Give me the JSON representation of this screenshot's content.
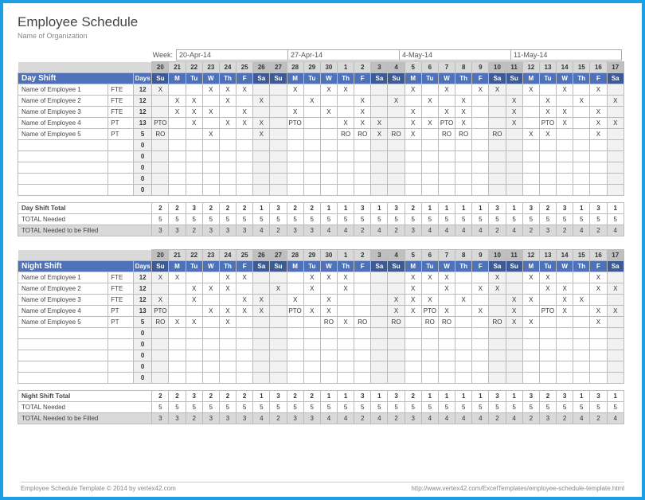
{
  "title": "Employee Schedule",
  "subtitle": "Name of Organization",
  "week_label": "Week:",
  "week_dates": [
    "20-Apr-14",
    "27-Apr-14",
    "4-May-14",
    "11-May-14"
  ],
  "day_nums": [
    "20",
    "21",
    "22",
    "23",
    "24",
    "25",
    "26",
    "27",
    "28",
    "29",
    "30",
    "1",
    "2",
    "3",
    "4",
    "5",
    "6",
    "7",
    "8",
    "9",
    "10",
    "11",
    "12",
    "13",
    "14",
    "15",
    "16",
    "17"
  ],
  "dow": [
    "Su",
    "M",
    "Tu",
    "W",
    "Th",
    "F",
    "Sa",
    "Su",
    "M",
    "Tu",
    "W",
    "Th",
    "F",
    "Sa",
    "Su",
    "M",
    "Tu",
    "W",
    "Th",
    "F",
    "Sa",
    "Su",
    "M",
    "Tu",
    "W",
    "Th",
    "F",
    "Sa"
  ],
  "weekend_idx": [
    0,
    6,
    7,
    13,
    14,
    20,
    21,
    27
  ],
  "shifts": [
    {
      "name": "Day Shift",
      "days_hdr": "Days",
      "employees": [
        {
          "name": "Name of Employee 1",
          "type": "FTE",
          "days": "12",
          "marks": [
            "X",
            "",
            "",
            "X",
            "X",
            "X",
            "",
            "",
            "X",
            "",
            "X",
            "X",
            "",
            "",
            "",
            "X",
            "",
            "X",
            "",
            "X",
            "X",
            "",
            "X",
            "",
            "X",
            "",
            "X",
            ""
          ]
        },
        {
          "name": "Name of Employee 2",
          "type": "FTE",
          "days": "12",
          "marks": [
            "",
            "X",
            "X",
            "",
            "X",
            "",
            "X",
            "",
            "",
            "X",
            "",
            "",
            "X",
            "",
            "X",
            "",
            "X",
            "",
            "X",
            "",
            "",
            "X",
            "",
            "X",
            "",
            "X",
            "",
            "X"
          ]
        },
        {
          "name": "Name of Employee 3",
          "type": "FTE",
          "days": "12",
          "marks": [
            "",
            "X",
            "X",
            "X",
            "",
            "X",
            "",
            "",
            "X",
            "",
            "X",
            "",
            "X",
            "",
            "",
            "X",
            "",
            "X",
            "X",
            "",
            "",
            "X",
            "",
            "X",
            "X",
            "",
            "X",
            ""
          ]
        },
        {
          "name": "Name of Employee 4",
          "type": "PT",
          "days": "13",
          "marks": [
            "PTO",
            "",
            "X",
            "",
            "X",
            "X",
            "X",
            "",
            "PTO",
            "",
            "",
            "X",
            "X",
            "X",
            "",
            "X",
            "X",
            "PTO",
            "X",
            "",
            "",
            "X",
            "",
            "PTO",
            "X",
            "",
            "X",
            "X"
          ]
        },
        {
          "name": "Name of Employee 5",
          "type": "PT",
          "days": "5",
          "marks": [
            "RO",
            "",
            "",
            "X",
            "",
            "",
            "X",
            "",
            "",
            "",
            "",
            "RO",
            "RO",
            "X",
            "RO",
            "X",
            "",
            "RO",
            "RO",
            "",
            "RO",
            "",
            "X",
            "X",
            "",
            "",
            "X",
            ""
          ]
        }
      ],
      "empty_rows": 5,
      "summary": [
        {
          "label": "Day Shift Total",
          "vals": [
            "2",
            "2",
            "3",
            "2",
            "2",
            "2",
            "1",
            "3",
            "2",
            "2",
            "1",
            "1",
            "3",
            "1",
            "3",
            "2",
            "1",
            "1",
            "1",
            "1",
            "3",
            "1",
            "3",
            "2",
            "3",
            "1",
            "3",
            "1"
          ],
          "cls": "total"
        },
        {
          "label": "TOTAL Needed",
          "vals": [
            "5",
            "5",
            "5",
            "5",
            "5",
            "5",
            "5",
            "5",
            "5",
            "5",
            "5",
            "5",
            "5",
            "5",
            "5",
            "5",
            "5",
            "5",
            "5",
            "5",
            "5",
            "5",
            "5",
            "5",
            "5",
            "5",
            "5",
            "5"
          ],
          "cls": "needed"
        },
        {
          "label": "TOTAL Needed to be Filled",
          "vals": [
            "3",
            "3",
            "2",
            "3",
            "3",
            "3",
            "4",
            "2",
            "3",
            "3",
            "4",
            "4",
            "2",
            "4",
            "2",
            "3",
            "4",
            "4",
            "4",
            "4",
            "2",
            "4",
            "2",
            "3",
            "2",
            "4",
            "2",
            "4"
          ],
          "cls": "fill"
        }
      ]
    },
    {
      "name": "Night Shift",
      "days_hdr": "Days",
      "employees": [
        {
          "name": "Name of Employee 1",
          "type": "FTE",
          "days": "12",
          "marks": [
            "X",
            "X",
            "",
            "",
            "X",
            "X",
            "",
            "",
            "",
            "X",
            "X",
            "X",
            "",
            "",
            "",
            "X",
            "X",
            "X",
            "",
            "",
            "X",
            "",
            "X",
            "X",
            "",
            "",
            "X",
            ""
          ]
        },
        {
          "name": "Name of Employee 2",
          "type": "FTE",
          "days": "12",
          "marks": [
            "",
            "",
            "X",
            "X",
            "X",
            "",
            "",
            "X",
            "",
            "X",
            "",
            "X",
            "",
            "",
            "",
            "X",
            "",
            "X",
            "",
            "X",
            "X",
            "",
            "",
            "X",
            "X",
            "",
            "X",
            "X"
          ]
        },
        {
          "name": "Name of Employee 3",
          "type": "FTE",
          "days": "12",
          "marks": [
            "X",
            "",
            "X",
            "",
            "",
            "X",
            "X",
            "",
            "X",
            "",
            "X",
            "",
            "",
            "",
            "X",
            "X",
            "X",
            "",
            "X",
            "",
            "",
            "X",
            "X",
            "",
            "X",
            "X",
            "",
            ""
          ]
        },
        {
          "name": "Name of Employee 4",
          "type": "PT",
          "days": "13",
          "marks": [
            "PTO",
            "",
            "",
            "X",
            "X",
            "X",
            "X",
            "",
            "PTO",
            "X",
            "X",
            "",
            "",
            "",
            "X",
            "X",
            "PTO",
            "X",
            "",
            "X",
            "",
            "X",
            "",
            "PTO",
            "X",
            "",
            "X",
            "X"
          ]
        },
        {
          "name": "Name of Employee 5",
          "type": "PT",
          "days": "5",
          "marks": [
            "RO",
            "X",
            "X",
            "",
            "X",
            "",
            "",
            "",
            "",
            "",
            "RO",
            "X",
            "RO",
            "",
            "RO",
            "",
            "RO",
            "RO",
            "",
            "",
            "RO",
            "X",
            "X",
            "",
            "",
            "",
            "X",
            ""
          ]
        }
      ],
      "empty_rows": 5,
      "summary": [
        {
          "label": "Night Shift Total",
          "vals": [
            "2",
            "2",
            "3",
            "2",
            "2",
            "2",
            "1",
            "3",
            "2",
            "2",
            "1",
            "1",
            "3",
            "1",
            "3",
            "2",
            "1",
            "1",
            "1",
            "1",
            "3",
            "1",
            "3",
            "2",
            "3",
            "1",
            "3",
            "1"
          ],
          "cls": "total"
        },
        {
          "label": "TOTAL Needed",
          "vals": [
            "5",
            "5",
            "5",
            "5",
            "5",
            "5",
            "5",
            "5",
            "5",
            "5",
            "5",
            "5",
            "5",
            "5",
            "5",
            "5",
            "5",
            "5",
            "5",
            "5",
            "5",
            "5",
            "5",
            "5",
            "5",
            "5",
            "5",
            "5"
          ],
          "cls": "needed"
        },
        {
          "label": "TOTAL Needed to be Filled",
          "vals": [
            "3",
            "3",
            "2",
            "3",
            "3",
            "3",
            "4",
            "2",
            "3",
            "3",
            "4",
            "4",
            "2",
            "4",
            "2",
            "3",
            "4",
            "4",
            "4",
            "4",
            "2",
            "4",
            "2",
            "3",
            "2",
            "4",
            "2",
            "4"
          ],
          "cls": "fill"
        }
      ]
    }
  ],
  "footer_left": "Employee Schedule Template © 2014 by vertex42.com",
  "footer_right": "http://www.vertex42.com/ExcelTemplates/employee-schedule-template.html"
}
